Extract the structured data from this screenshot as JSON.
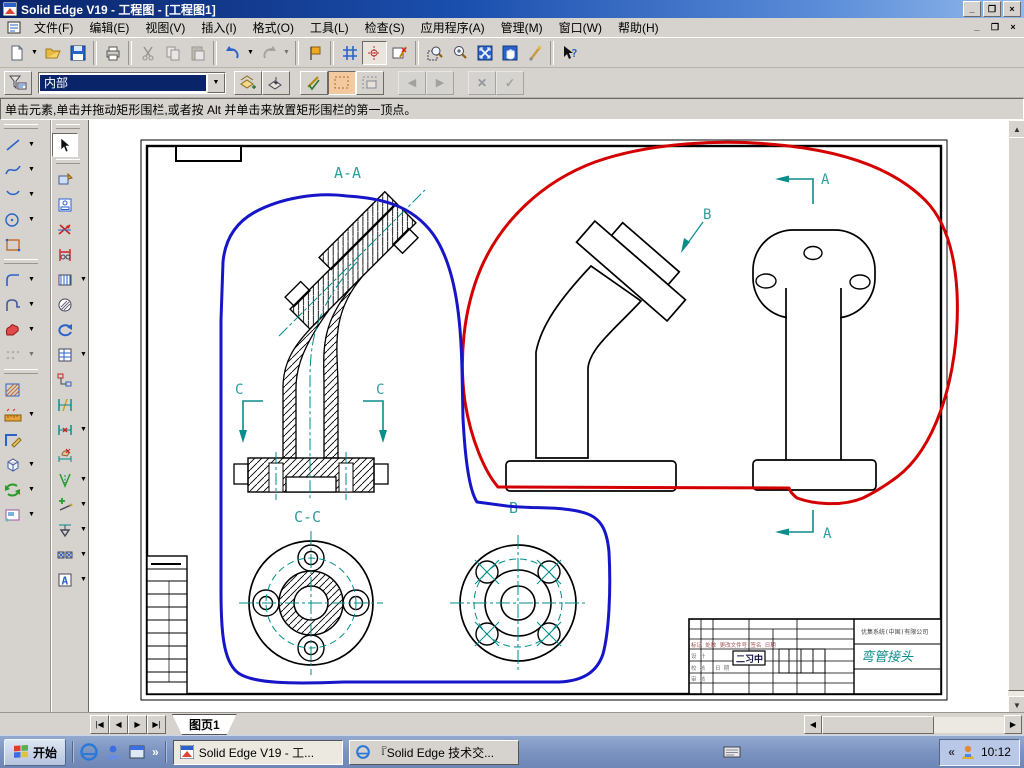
{
  "window": {
    "title": "Solid Edge V19 - 工程图 - [工程图1]"
  },
  "menubar": {
    "items": [
      "文件(F)",
      "编辑(E)",
      "视图(V)",
      "插入(I)",
      "格式(O)",
      "工具(L)",
      "检查(S)",
      "应用程序(A)",
      "管理(M)",
      "窗口(W)",
      "帮助(H)"
    ]
  },
  "toolbar_main": {
    "icons": [
      "new",
      "open",
      "save",
      "print",
      "cut",
      "copy",
      "paste",
      "undo",
      "redo",
      "goto-flag",
      "grid",
      "alignment-target",
      "sketch-view",
      "zoom-area",
      "zoom",
      "fit",
      "pan",
      "appearance-wand",
      "help"
    ]
  },
  "toolbar_select": {
    "icons": [
      "query-filter",
      "overlay-add",
      "overlay",
      "draw-check",
      "fence-inside",
      "fence-overlap",
      "back",
      "forward",
      "cancel",
      "accept"
    ],
    "query_value": "内部"
  },
  "prompt": {
    "text": "单击元素,单击并拖动矩形围栏,或者按 Alt 并单击来放置矩形围栏的第一顶点。"
  },
  "palette": {
    "draw_tools": [
      "line",
      "curve",
      "arc",
      "circle",
      "rectangle",
      "fillet",
      "chamfer",
      "fill",
      "pattern",
      "hatch",
      "dimension-ruler",
      "edge-paint",
      "box-3d",
      "refresh",
      "image"
    ],
    "view_tools": [
      "select",
      "view-wizard",
      "drawing-view",
      "principal-view",
      "cutting-plane",
      "section",
      "detail-view",
      "update-view",
      "parts-list",
      "connector",
      "smart-dimension",
      "distance-between",
      "dimension-free",
      "dimension-angle",
      "annotation-plus",
      "datum-frame",
      "symbol",
      "text-profile"
    ]
  },
  "drawing": {
    "labels": {
      "section_aa": "A-A",
      "c_left": "C",
      "c_right": "C",
      "section_cc": "C-C",
      "view_b_arrow": "B",
      "view_b_label": "B",
      "arrow_a_top": "A",
      "arrow_a_bottom": "A"
    },
    "title_block": {
      "company": "优集系统(中国)有限公司",
      "part_name": "弯管接头",
      "stamp": "二习中",
      "row_labels": "标记 处数 更改文件号 签名 日期",
      "cell_labels": {
        "c1": "设 计",
        "c2": "校 核",
        "c3": "审 核",
        "c4": "日 期"
      }
    },
    "colors": {
      "outline_red": "#d40000",
      "outline_blue": "#1616c8",
      "centerline_teal": "#008b8b"
    }
  },
  "sheet_tabs": {
    "active": "图页1"
  },
  "taskbar": {
    "start_label": "开始",
    "tasks": [
      "Solid Edge V19 - 工...",
      "『Solid Edge 技术交..."
    ],
    "clock": "10:12"
  }
}
